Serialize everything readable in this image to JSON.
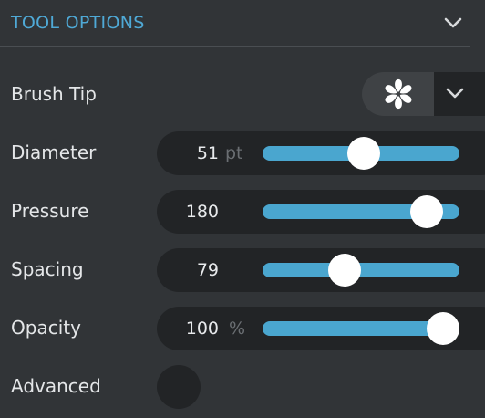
{
  "panel": {
    "title": "TOOL OPTIONS",
    "collapse_icon": "chevron-down-icon",
    "accent_color": "#4fa9d6"
  },
  "brush_tip": {
    "label": "Brush Tip",
    "icon": "flower-brush-icon",
    "dropdown_icon": "chevron-down-icon"
  },
  "sliders": [
    {
      "label": "Diameter",
      "value": "51",
      "unit": "pt",
      "level": 0.51
    },
    {
      "label": "Pressure",
      "value": "180",
      "unit": "",
      "level": 0.83
    },
    {
      "label": "Spacing",
      "value": "79",
      "unit": "",
      "level": 0.41
    },
    {
      "label": "Opacity",
      "value": "100",
      "unit": "%",
      "level": 1.0
    }
  ],
  "advanced": {
    "label": "Advanced",
    "state": "off"
  }
}
